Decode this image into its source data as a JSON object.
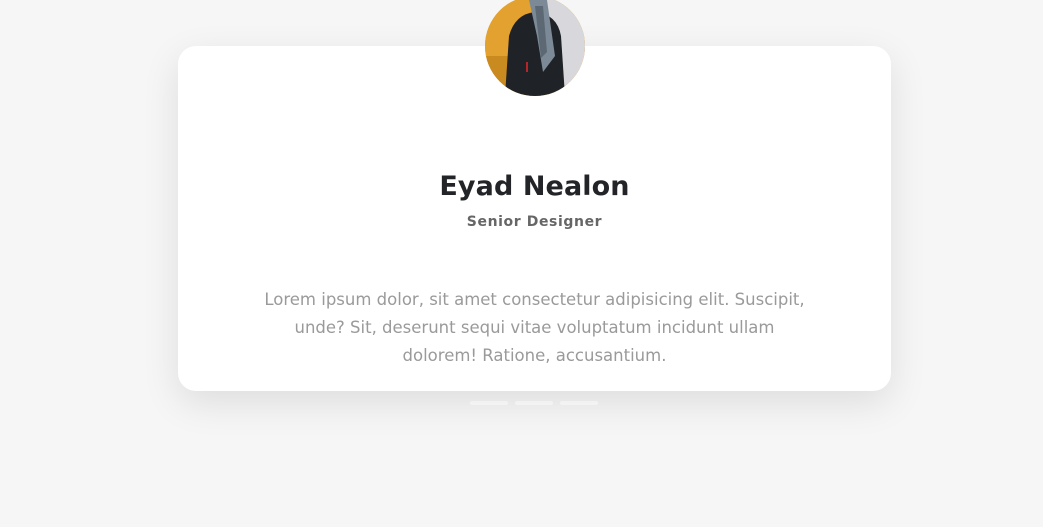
{
  "testimonial": {
    "name": "Eyad Nealon",
    "role": "Senior Designer",
    "quote": "Lorem ipsum dolor, sit amet consectetur adipisicing elit. Suscipit, unde? Sit, deserunt sequi vitae voluptatum incidunt ullam dolorem! Ratione, accusantium."
  },
  "slider": {
    "slide_count": 3,
    "active_index": 0
  },
  "colors": {
    "background": "#f6f6f6",
    "card": "#ffffff",
    "name": "#222428",
    "role": "#666666",
    "quote": "#9a9a9a"
  }
}
